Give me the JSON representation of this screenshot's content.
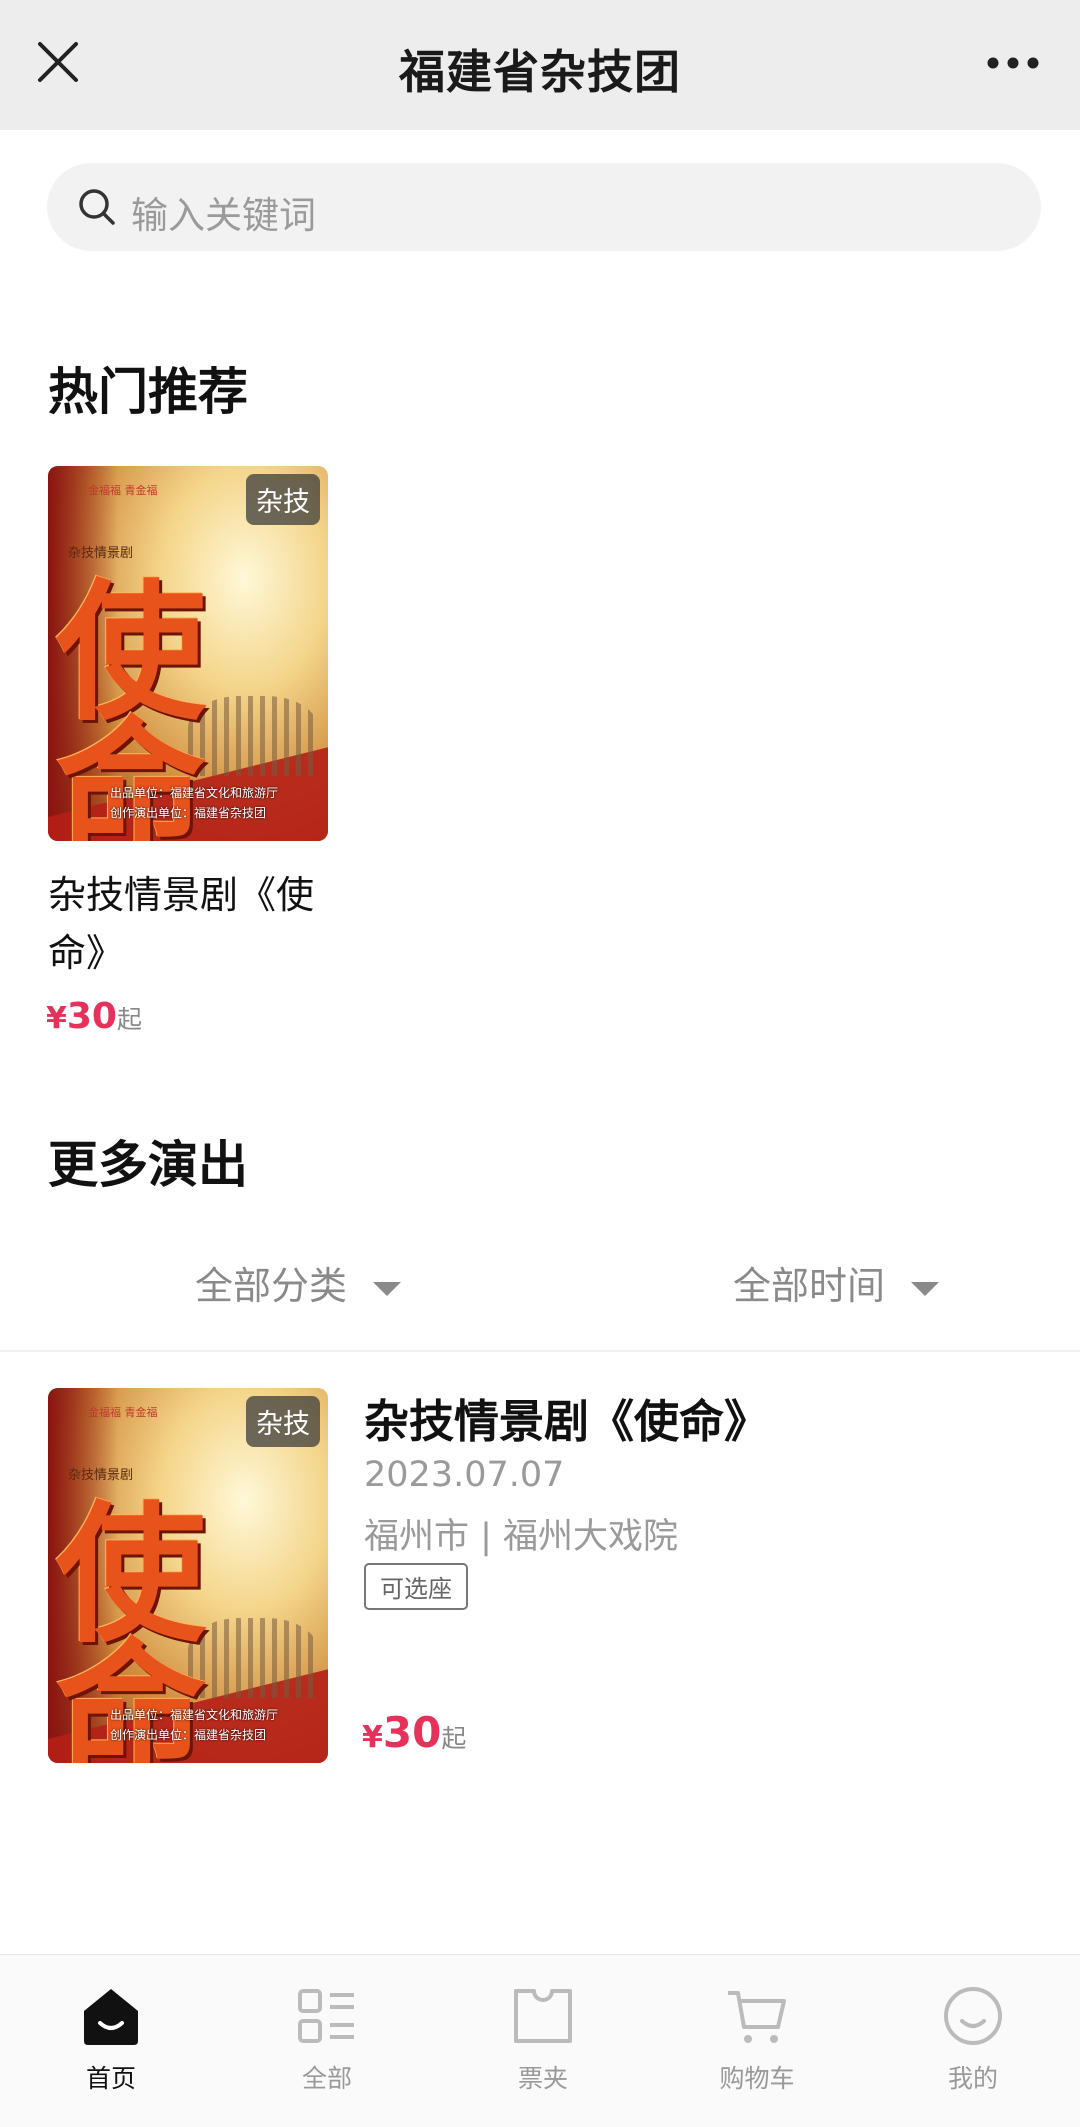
{
  "header": {
    "title": "福建省杂技团"
  },
  "search": {
    "placeholder": "输入关键词"
  },
  "hot": {
    "section_title": "热门推荐",
    "item": {
      "tag": "杂技",
      "name": "杂技情景剧《使命》",
      "currency": "¥",
      "price": "30",
      "price_suffix": "起",
      "poster": {
        "logo": "金福福 青金福",
        "subtitle": "杂技情景剧",
        "chars": [
          "使",
          "命"
        ],
        "credit_1": "出品单位：福建省文化和旅游厅",
        "credit_2": "创作演出单位：福建省杂技团"
      }
    }
  },
  "more": {
    "section_title": "更多演出",
    "filter_category": "全部分类",
    "filter_time": "全部时间",
    "item": {
      "tag": "杂技",
      "title": "杂技情景剧《使命》",
      "date": "2023.07.07",
      "venue": "福州市 | 福州大戏院",
      "badge": "可选座",
      "currency": "¥",
      "price": "30",
      "price_suffix": "起"
    }
  },
  "tabbar": {
    "items": [
      {
        "label": "首页",
        "icon": "home-icon",
        "active": true
      },
      {
        "label": "全部",
        "icon": "list-icon",
        "active": false
      },
      {
        "label": "票夹",
        "icon": "ticket-icon",
        "active": false
      },
      {
        "label": "购物车",
        "icon": "cart-icon",
        "active": false
      },
      {
        "label": "我的",
        "icon": "smile-icon",
        "active": false
      }
    ]
  },
  "colors": {
    "accent_price": "#e6325a",
    "header_bg": "#ededed"
  }
}
